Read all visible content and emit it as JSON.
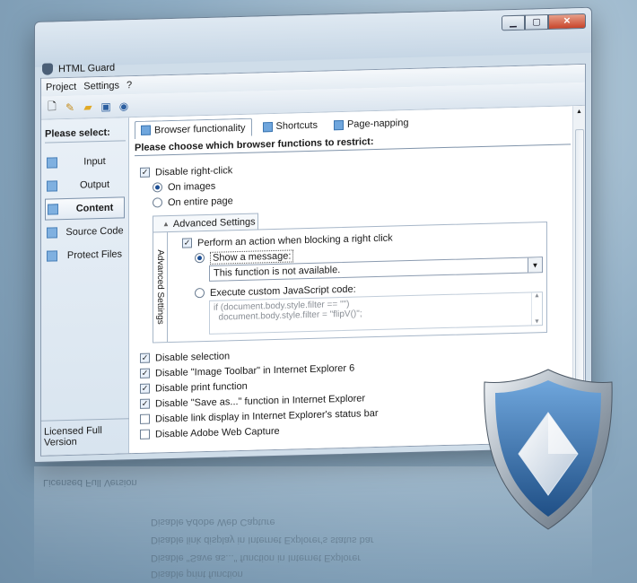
{
  "window": {
    "title": "HTML Guard"
  },
  "menu": [
    "Project",
    "Settings",
    "?"
  ],
  "sidebar": {
    "title": "Please select:",
    "items": [
      {
        "label": "Input"
      },
      {
        "label": "Output"
      },
      {
        "label": "Content",
        "active": true
      },
      {
        "label": "Source Code"
      },
      {
        "label": "Protect Files"
      }
    ],
    "footer": "Licensed Full Version"
  },
  "tabs": [
    {
      "label": "Browser functionality",
      "active": true
    },
    {
      "label": "Shortcuts"
    },
    {
      "label": "Page-napping"
    }
  ],
  "main": {
    "heading": "Please choose which browser functions to restrict:",
    "disable_right_click": "Disable right-click",
    "on_images": "On images",
    "on_entire_page": "On entire page",
    "advanced_tab": "Advanced Settings",
    "advanced_side": "Advanced Settings",
    "perform_action": "Perform an action when blocking a right click",
    "show_message": "Show a message:",
    "message_value": "This function is not available.",
    "execute_js": "Execute custom JavaScript code:",
    "code_line1": "if (document.body.style.filter == \"\")",
    "code_line2": "  document.body.style.filter = \"flipV()\";",
    "options": [
      {
        "label": "Disable selection",
        "checked": true
      },
      {
        "label": "Disable \"Image Toolbar\" in Internet Explorer 6",
        "checked": true
      },
      {
        "label": "Disable print function",
        "checked": true
      },
      {
        "label": "Disable \"Save as...\" function in Internet Explorer",
        "checked": true
      },
      {
        "label": "Disable link display in Internet Explorer's status bar",
        "checked": false
      },
      {
        "label": "Disable Adobe Web Capture",
        "checked": false
      }
    ]
  },
  "reflection": {
    "footer": "Licensed Full Version",
    "lines": [
      "Disable Adobe Web Capture",
      "Disable link display in Internet Explorer's status bar",
      "Disable \"Save as...\" function in Internet Explorer",
      "Disable print function"
    ]
  },
  "icons": {
    "app": "shield-icon",
    "logo": "html-guard-shield-logo",
    "toolbar": [
      "new-file-icon",
      "wand-icon",
      "open-folder-icon",
      "save-icon",
      "help-icon"
    ]
  },
  "colors": {
    "accent": "#3c76b1",
    "shield_blue": "#2f6fb0"
  }
}
